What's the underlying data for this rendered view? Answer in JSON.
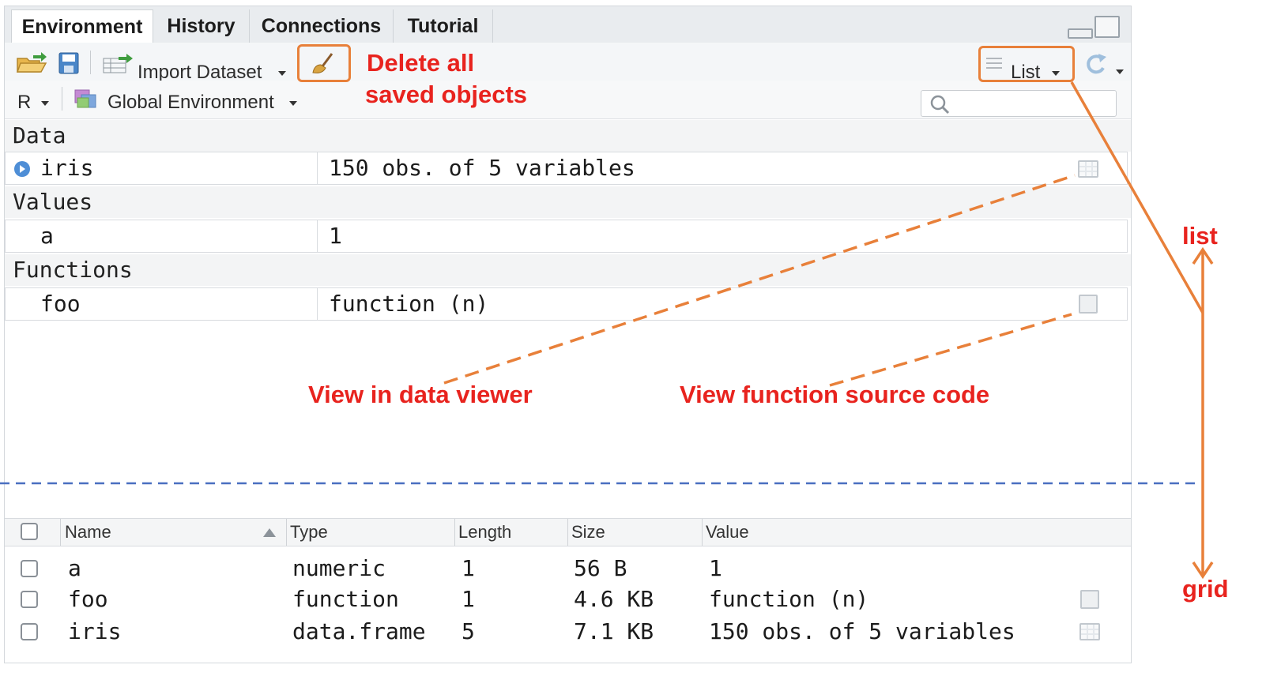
{
  "tabs": [
    "Environment",
    "History",
    "Connections",
    "Tutorial"
  ],
  "toolbar": {
    "import_label": "Import Dataset",
    "view_mode_label": "List",
    "language_label": "R",
    "env_label": "Global Environment"
  },
  "list_view": {
    "sections": [
      "Data",
      "Values",
      "Functions"
    ],
    "data_rows": [
      {
        "name": "iris",
        "value": "150 obs. of 5 variables"
      }
    ],
    "value_rows": [
      {
        "name": "a",
        "value": "1"
      }
    ],
    "function_rows": [
      {
        "name": "foo",
        "value": "function (n)"
      }
    ]
  },
  "grid_view": {
    "headers": [
      "Name",
      "Type",
      "Length",
      "Size",
      "Value"
    ],
    "rows": [
      {
        "name": "a",
        "type": "numeric",
        "length": "1",
        "size": "56 B",
        "value": "1"
      },
      {
        "name": "foo",
        "type": "function",
        "length": "1",
        "size": "4.6 KB",
        "value": "function (n)"
      },
      {
        "name": "iris",
        "type": "data.frame",
        "length": "5",
        "size": "7.1 KB",
        "value": "150 obs. of 5 variables"
      }
    ]
  },
  "annotations": {
    "delete_line1": "Delete all",
    "delete_line2": "saved objects",
    "data_viewer": "View in data viewer",
    "function_source": "View function source code",
    "list": "list",
    "grid": "grid"
  },
  "colors": {
    "annotation_red": "#e8231e",
    "annotation_orange": "#e8803a",
    "separator_blue": "#4a6fc0"
  }
}
